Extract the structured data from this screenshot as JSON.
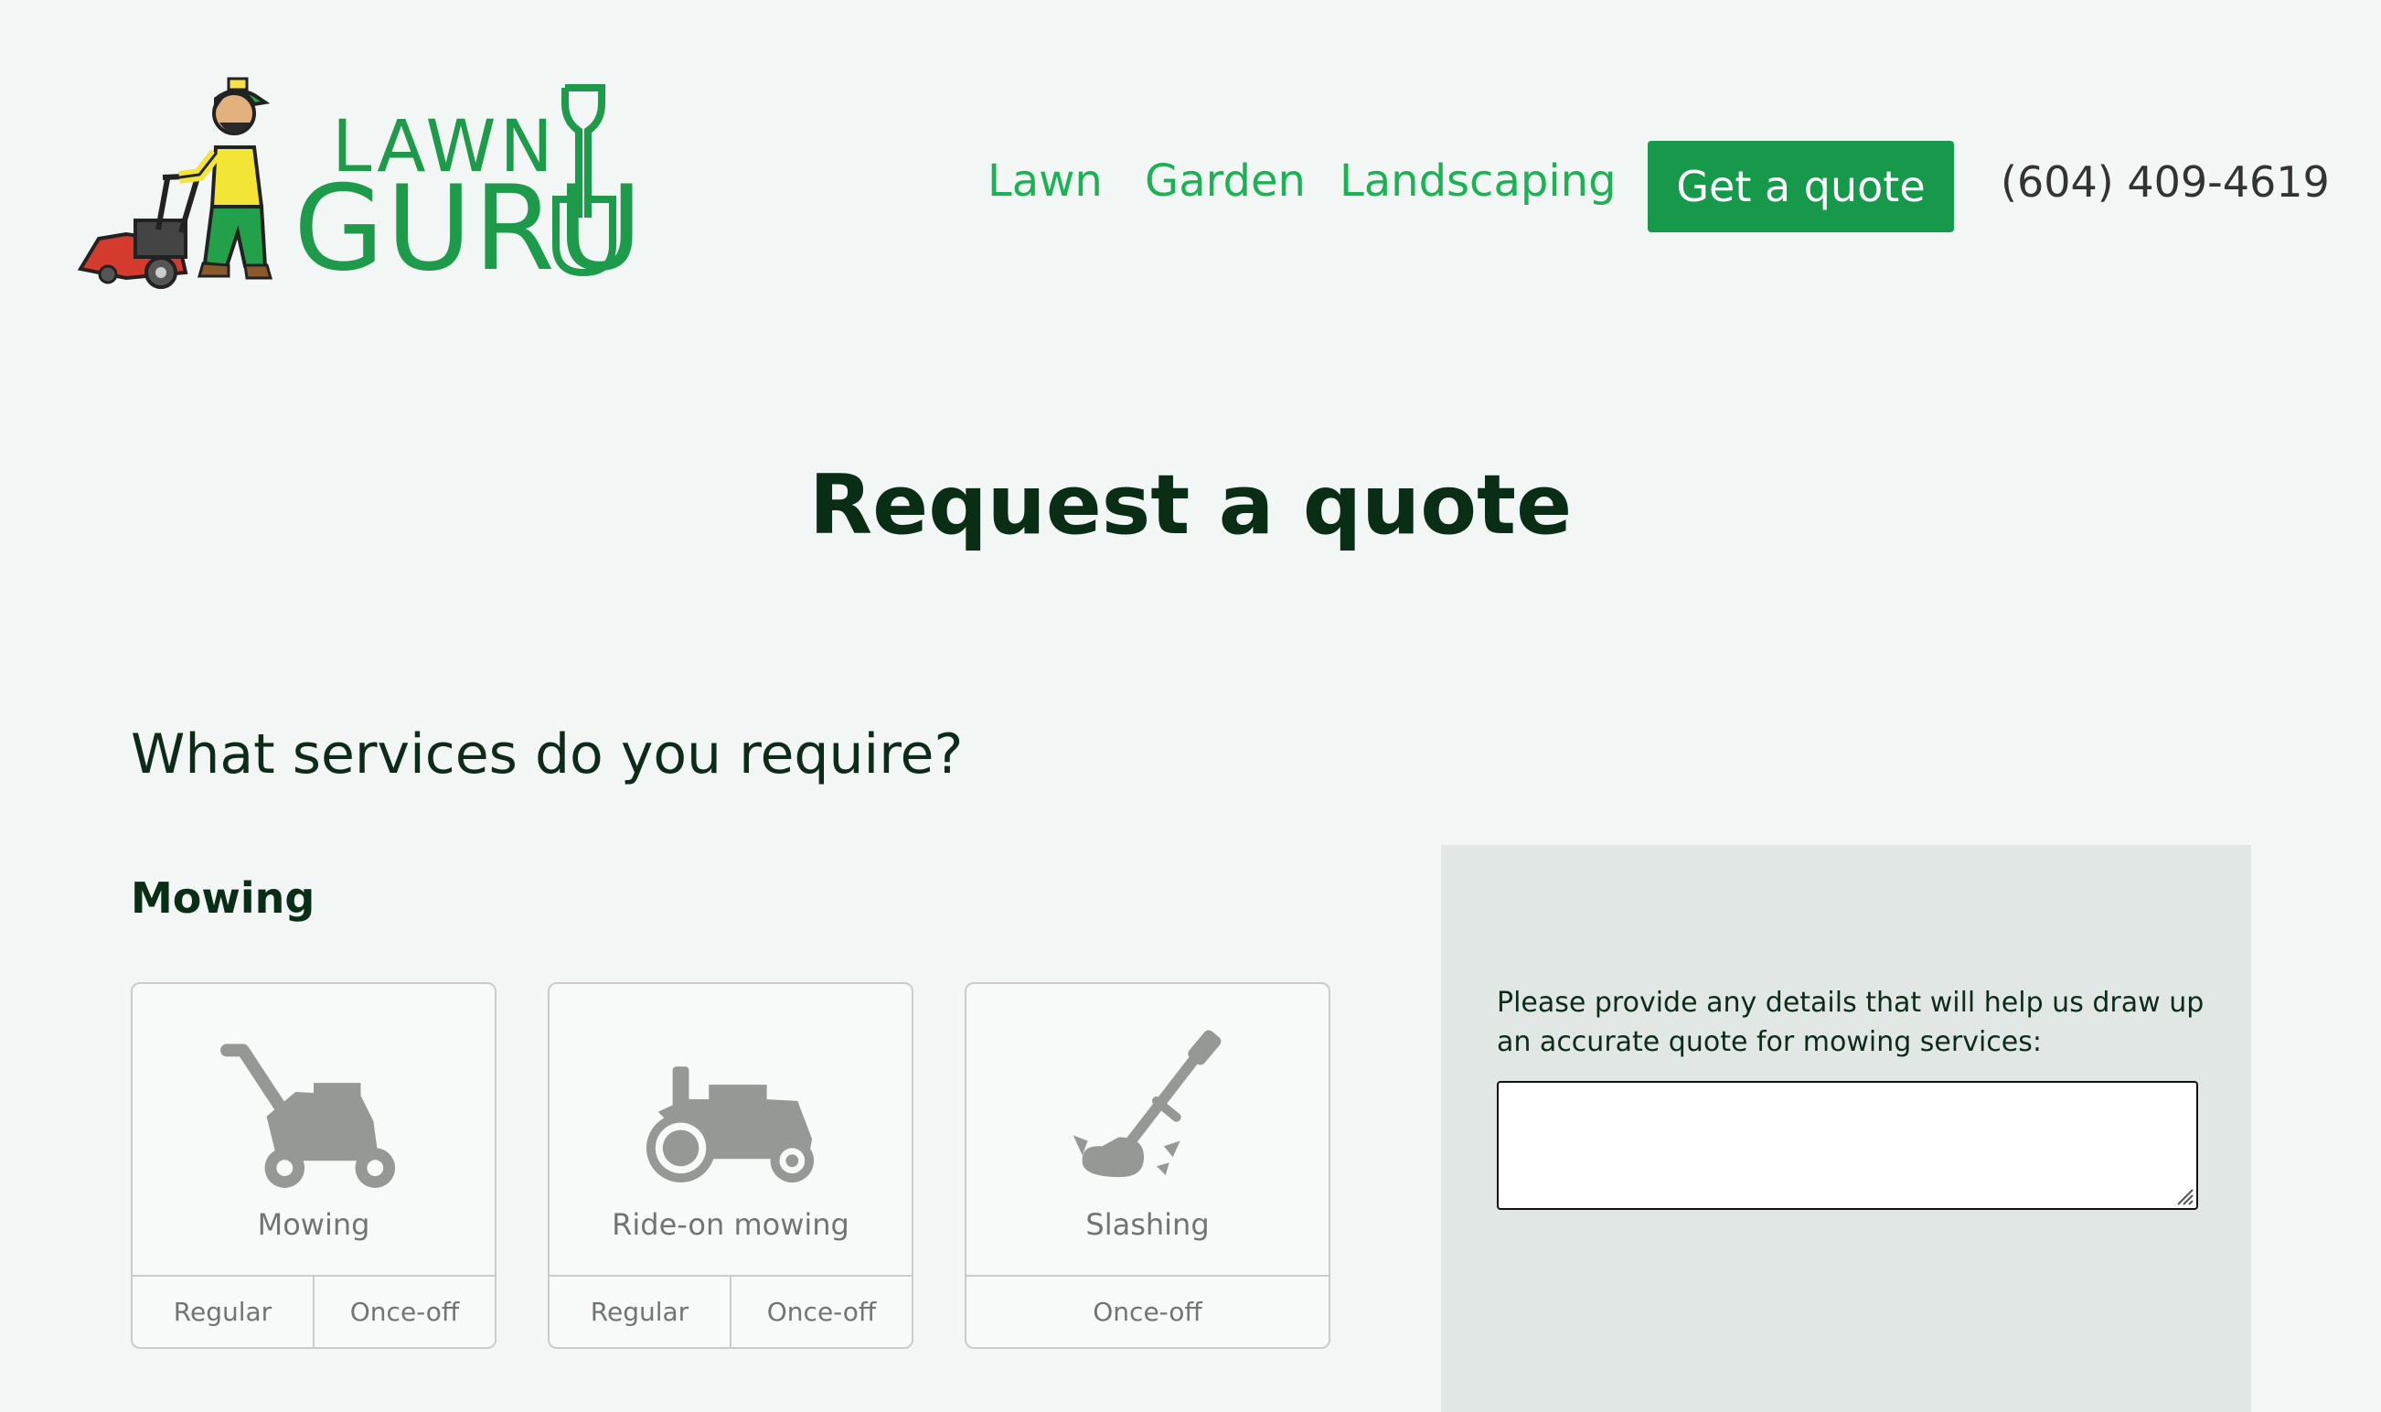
{
  "header": {
    "logo": {
      "line1": "LAWN",
      "line2": "GURU"
    },
    "nav": [
      {
        "label": "Lawn"
      },
      {
        "label": "Garden"
      },
      {
        "label": "Landscaping"
      }
    ],
    "cta_label": "Get a quote",
    "phone": "(604) 409-4619"
  },
  "main": {
    "title": "Request a quote",
    "question": "What services do you require?",
    "category": "Mowing",
    "services": [
      {
        "name": "Mowing",
        "icon": "push-mower-icon",
        "options": [
          "Regular",
          "Once-off"
        ]
      },
      {
        "name": "Ride-on mowing",
        "icon": "ride-on-mower-icon",
        "options": [
          "Regular",
          "Once-off"
        ]
      },
      {
        "name": "Slashing",
        "icon": "trimmer-icon",
        "options": [
          "Once-off"
        ]
      }
    ],
    "details": {
      "label": "Please provide any details that will help us draw up an accurate quote for mowing services:",
      "value": ""
    }
  },
  "colors": {
    "brand_green": "#1e9b4a",
    "nav_green": "#1bb253",
    "button_green": "#16994a",
    "background": "#f2f6f4",
    "panel": "#e1e7e4",
    "icon_gray": "#969896"
  }
}
